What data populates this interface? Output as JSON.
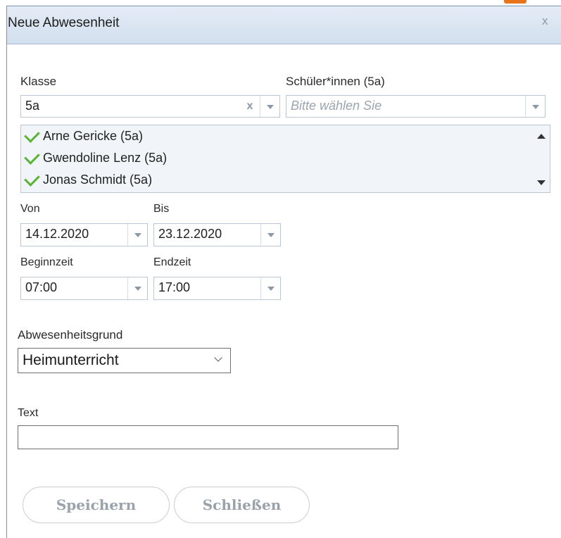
{
  "dialog": {
    "title": "Neue Abwesenheit",
    "close_label": "x"
  },
  "klasse": {
    "label": "Klasse",
    "value": "5a",
    "clear_label": "x"
  },
  "schueler": {
    "label": "Schüler*innen (5a)",
    "placeholder": "Bitte wählen Sie"
  },
  "selected_students": [
    {
      "name": "Arne Gericke (5a)"
    },
    {
      "name": "Gwendoline Lenz (5a)"
    },
    {
      "name": "Jonas Schmidt (5a)"
    }
  ],
  "von": {
    "label": "Von",
    "value": "14.12.2020"
  },
  "bis": {
    "label": "Bis",
    "value": "23.12.2020"
  },
  "beginnzeit": {
    "label": "Beginnzeit",
    "value": "07:00"
  },
  "endzeit": {
    "label": "Endzeit",
    "value": "17:00"
  },
  "grund": {
    "label": "Abwesenheitsgrund",
    "value": "Heimunterricht"
  },
  "text": {
    "label": "Text",
    "value": ""
  },
  "buttons": {
    "save": "Speichern",
    "close": "Schließen"
  },
  "colors": {
    "accent_orange": "#e8741a",
    "check_green": "#5bb335",
    "titlebar": "#d9e4f1"
  },
  "icons": {
    "check": "check-icon",
    "dropdown": "triangle-down-icon",
    "clear": "clear-icon",
    "scroll_up": "chevron-up-icon",
    "scroll_down": "chevron-down-icon"
  }
}
